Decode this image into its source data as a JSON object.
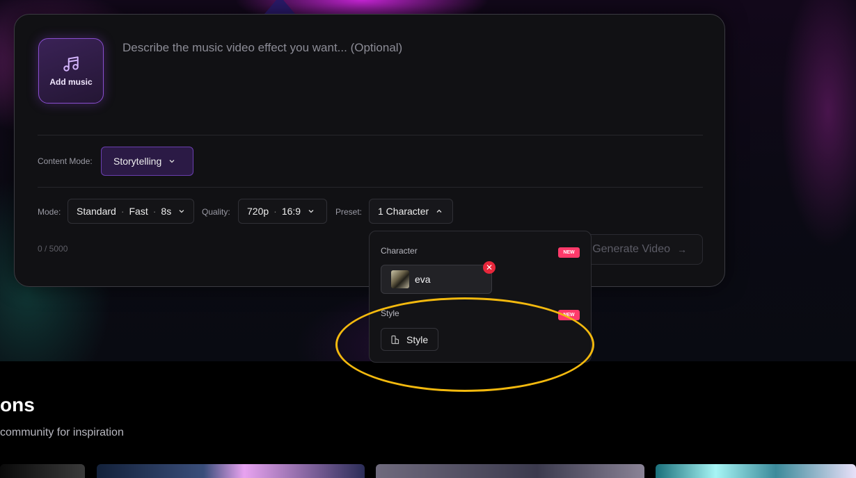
{
  "composer": {
    "add_music_label": "Add music",
    "prompt_placeholder": "Describe the music video effect you want... (Optional)",
    "content_mode": {
      "label": "Content Mode:",
      "value": "Storytelling"
    },
    "mode": {
      "label": "Mode:",
      "value": "Standard",
      "speed": "Fast",
      "duration": "8s"
    },
    "quality": {
      "label": "Quality:",
      "resolution": "720p",
      "aspect": "16:9"
    },
    "preset": {
      "label": "Preset:",
      "value": "1 Character",
      "expanded": true
    },
    "char_count": "0 / 5000",
    "generate_label": "Generate Video"
  },
  "preset_popover": {
    "character": {
      "label": "Character",
      "badge": "NEW",
      "selected_name": "eva"
    },
    "style": {
      "label": "Style",
      "badge": "NEW",
      "button_label": "Style"
    }
  },
  "section": {
    "title": "ons",
    "subtitle": "community for inspiration"
  },
  "annotation": {
    "color": "#f3b90e",
    "shape": "ellipse"
  },
  "colors": {
    "accent": "#8a4fd0",
    "badge": "#ff3a6a",
    "remove": "#e8273b"
  }
}
